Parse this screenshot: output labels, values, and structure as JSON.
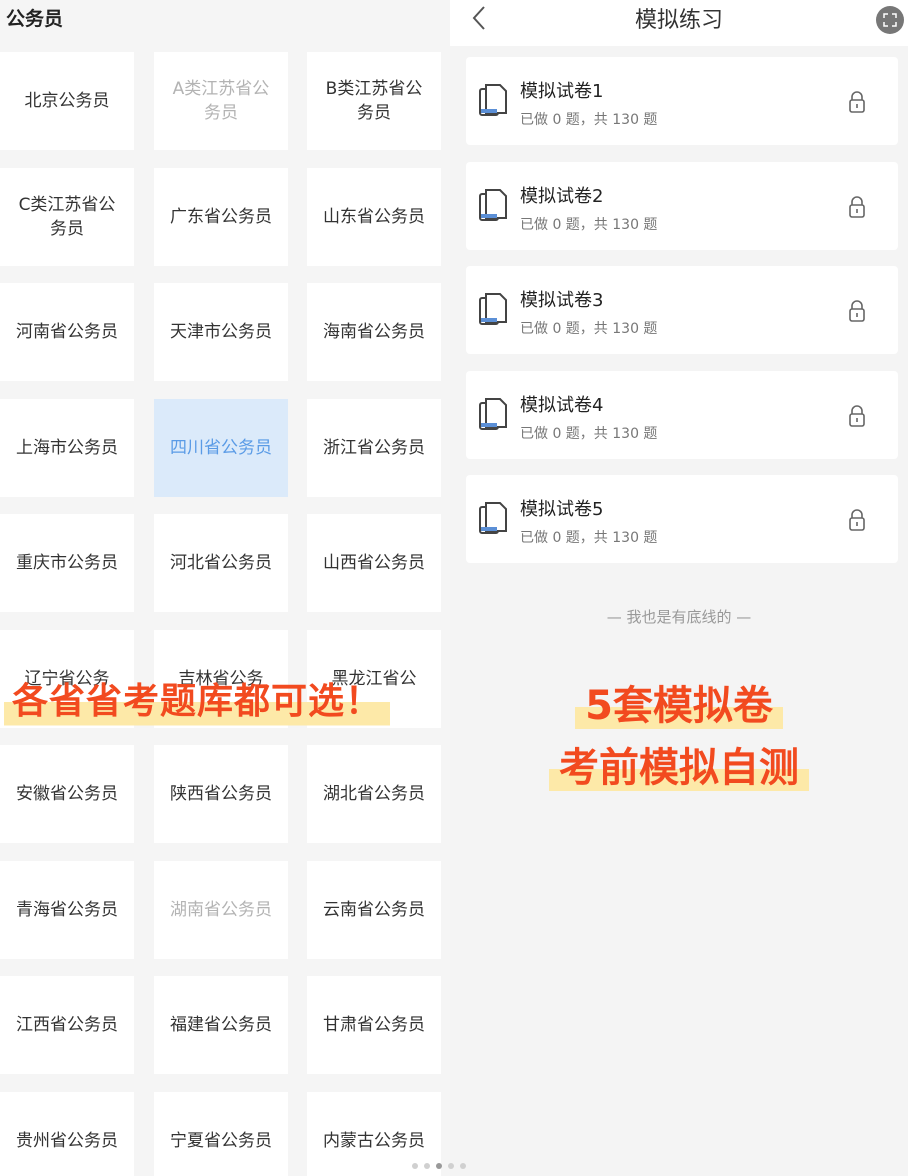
{
  "left": {
    "title": "公务员",
    "cells": [
      {
        "label": "北京公务员",
        "state": "normal"
      },
      {
        "label": "A类江苏省公务员",
        "state": "muted"
      },
      {
        "label": "B类江苏省公务员",
        "state": "normal"
      },
      {
        "label": "C类江苏省公务员",
        "state": "normal"
      },
      {
        "label": "广东省公务员",
        "state": "normal"
      },
      {
        "label": "山东省公务员",
        "state": "normal"
      },
      {
        "label": "河南省公务员",
        "state": "normal"
      },
      {
        "label": "天津市公务员",
        "state": "normal"
      },
      {
        "label": "海南省公务员",
        "state": "normal"
      },
      {
        "label": "上海市公务员",
        "state": "normal"
      },
      {
        "label": "四川省公务员",
        "state": "selected"
      },
      {
        "label": "浙江省公务员",
        "state": "normal"
      },
      {
        "label": "重庆市公务员",
        "state": "normal"
      },
      {
        "label": "河北省公务员",
        "state": "normal"
      },
      {
        "label": "山西省公务员",
        "state": "normal"
      },
      {
        "label": "辽宁省公务",
        "state": "normal"
      },
      {
        "label": "吉林省公务",
        "state": "normal"
      },
      {
        "label": "黑龙江省公",
        "state": "normal"
      },
      {
        "label": "安徽省公务员",
        "state": "normal"
      },
      {
        "label": "陕西省公务员",
        "state": "normal"
      },
      {
        "label": "湖北省公务员",
        "state": "normal"
      },
      {
        "label": "青海省公务员",
        "state": "normal"
      },
      {
        "label": "湖南省公务员",
        "state": "muted"
      },
      {
        "label": "云南省公务员",
        "state": "normal"
      },
      {
        "label": "江西省公务员",
        "state": "normal"
      },
      {
        "label": "福建省公务员",
        "state": "normal"
      },
      {
        "label": "甘肃省公务员",
        "state": "normal"
      },
      {
        "label": "贵州省公务员",
        "state": "normal"
      },
      {
        "label": "宁夏省公务员",
        "state": "normal"
      },
      {
        "label": "内蒙古公务员",
        "state": "normal"
      }
    ],
    "banner": "各省省考题库都可选！"
  },
  "right": {
    "nav_title": "模拟练习",
    "papers": [
      {
        "title": "模拟试卷1",
        "subtitle": "已做 0 题，共 130 题"
      },
      {
        "title": "模拟试卷2",
        "subtitle": "已做 0 题，共 130 题"
      },
      {
        "title": "模拟试卷3",
        "subtitle": "已做 0 题，共 130 题"
      },
      {
        "title": "模拟试卷4",
        "subtitle": "已做 0 题，共 130 题"
      },
      {
        "title": "模拟试卷5",
        "subtitle": "已做 0 题，共 130 题"
      }
    ],
    "footer": "— 我也是有底线的 —",
    "promo_line1": "5套模拟卷",
    "promo_line2": "考前模拟自测"
  },
  "colors": {
    "accent": "#f24a1f",
    "highlight": "#fde9a8",
    "selected_bg": "#dbeafa",
    "selected_text": "#5a9be6"
  },
  "icons": {
    "back": "chevron-left-icon",
    "fullscreen": "expand-icon",
    "paper": "document-icon",
    "lock": "lock-icon"
  },
  "pager": {
    "count": 5,
    "active": 3
  }
}
